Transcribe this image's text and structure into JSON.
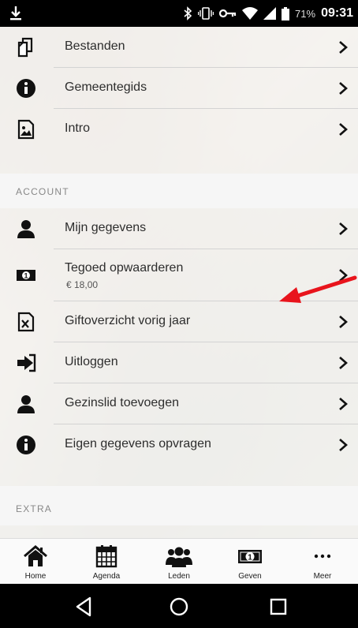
{
  "status_bar": {
    "battery_percent": "71%",
    "time": "09:31"
  },
  "top_items": [
    {
      "label": "Bestanden",
      "icon": "files-icon"
    },
    {
      "label": "Gemeentegids",
      "icon": "info-icon"
    },
    {
      "label": "Intro",
      "icon": "image-file-icon"
    }
  ],
  "account": {
    "header": "ACCOUNT",
    "items": [
      {
        "label": "Mijn gegevens",
        "icon": "person-icon"
      },
      {
        "label": "Tegoed opwaarderen",
        "sub": "€ 18,00",
        "icon": "money-icon"
      },
      {
        "label": "Giftoverzicht vorig jaar",
        "icon": "excel-file-icon"
      },
      {
        "label": "Uitloggen",
        "icon": "logout-icon"
      },
      {
        "label": "Gezinslid toevoegen",
        "icon": "person-icon"
      },
      {
        "label": "Eigen gegevens opvragen",
        "icon": "info-icon"
      }
    ]
  },
  "extra": {
    "header": "EXTRA"
  },
  "tabs": [
    {
      "label": "Home",
      "icon": "home-icon"
    },
    {
      "label": "Agenda",
      "icon": "calendar-icon"
    },
    {
      "label": "Leden",
      "icon": "group-icon"
    },
    {
      "label": "Geven",
      "icon": "money-icon"
    },
    {
      "label": "Meer",
      "icon": "more-icon"
    }
  ],
  "colors": {
    "accent_arrow": "#e8141c",
    "status_bar": "#000000",
    "text": "#2d2d2d"
  }
}
